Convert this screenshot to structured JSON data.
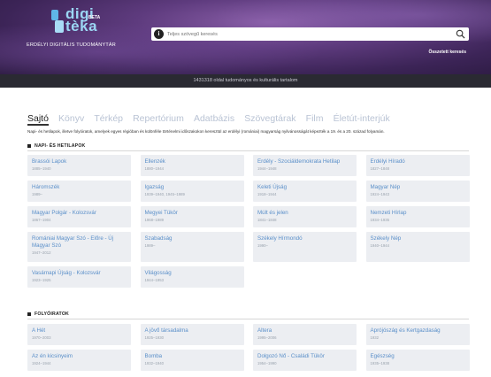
{
  "brand": {
    "logo_text": "digi tèka",
    "beta": "BETA",
    "tagline": "ERDÉLYI DIGITÁLIS TUDOMÁNYTÁR"
  },
  "search": {
    "placeholder": "Teljes szövegű keresés"
  },
  "advanced_search_label": "Összetett keresés",
  "stats": "1431318 oldal tudományos és kulturális tartalom",
  "tabs": [
    "Sajtó",
    "Könyv",
    "Térkép",
    "Repertórium",
    "Adatbázis",
    "Szövegtárak",
    "Film",
    "Életút-interjúk"
  ],
  "intro": "Napi- és hetilapok, illetve folyóiratok, amelyek egyes régióban és különféle történelmi időszakokon keresztül az erdélyi (romániai) magyarság nyilvánosságát képezték a 19. és a 20. század folyamán.",
  "sections": [
    {
      "title": "NAPI- ÉS HETILAPOK",
      "items": [
        {
          "name": "Brassói Lapok",
          "years": "1885–1940"
        },
        {
          "name": "Ellenzék",
          "years": "1880–1944"
        },
        {
          "name": "Erdély - Szociáldemokrata Hetilap",
          "years": "1944–1948"
        },
        {
          "name": "Erdélyi Híradó",
          "years": "1827–1848"
        },
        {
          "name": "Háromszék",
          "years": "1989–"
        },
        {
          "name": "Igazság",
          "years": "1939–1940, 1945–1989"
        },
        {
          "name": "Keleti Újság",
          "years": "1918–1944"
        },
        {
          "name": "Magyar Nép",
          "years": "1924–1943"
        },
        {
          "name": "Magyar Polgár - Kolozsvár",
          "years": "1867–1904"
        },
        {
          "name": "Megyei Tükör",
          "years": "1968–1989"
        },
        {
          "name": "Múlt és jelen",
          "years": "1841–1848"
        },
        {
          "name": "Nemzeti Hírlap",
          "years": "1934–1935"
        },
        {
          "name": "Romániai Magyar Szó - Előre - Új Magyar Szó",
          "years": "1947–2012"
        },
        {
          "name": "Szabadság",
          "years": "1989–"
        },
        {
          "name": "Székely Hírmondó",
          "years": "1990–"
        },
        {
          "name": "Székely Nép",
          "years": "1940–1944"
        },
        {
          "name": "Vasárnapi Újság - Kolozsvár",
          "years": "1923–1925"
        },
        {
          "name": "Világosság",
          "years": "1944–1953"
        }
      ]
    },
    {
      "title": "FOLYÓIRATOK",
      "items": [
        {
          "name": "A Hét",
          "years": "1970–2003"
        },
        {
          "name": "A jövő társadalma",
          "years": "1925–1930"
        },
        {
          "name": "Altera",
          "years": "1995–2006"
        },
        {
          "name": "Aprójószág és Kertgazdaság",
          "years": "1932"
        },
        {
          "name": "Az én kicsinyeim",
          "years": "1924–1944"
        },
        {
          "name": "Bomba",
          "years": "1932–1940"
        },
        {
          "name": "Dolgozó Nő - Családi Tükör",
          "years": "1954–1990"
        },
        {
          "name": "Egészség",
          "years": "1935–1938"
        }
      ]
    }
  ]
}
